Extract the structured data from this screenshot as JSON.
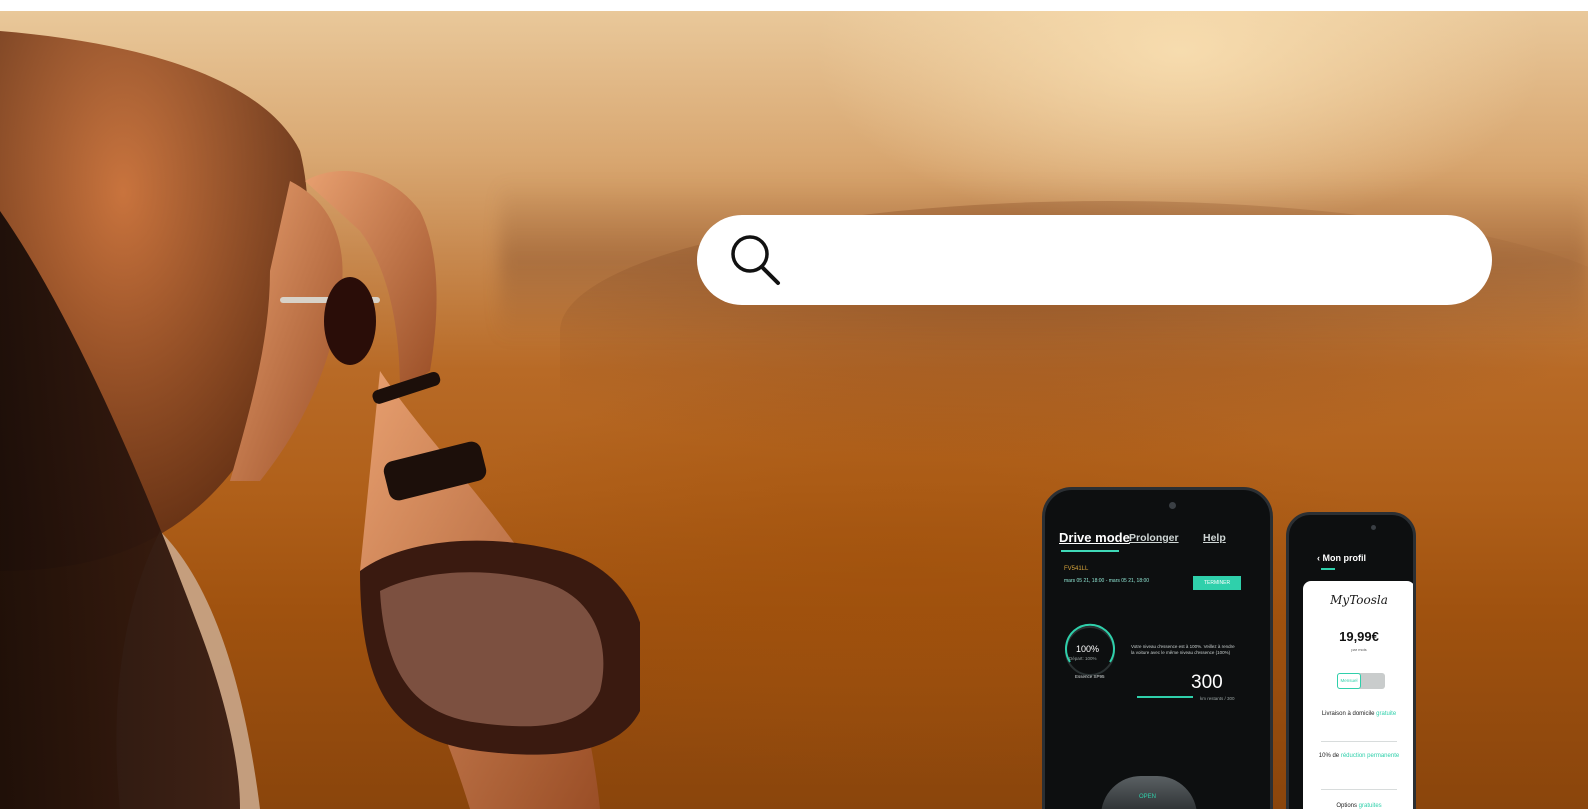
{
  "search": {
    "placeholder": "",
    "value": ""
  },
  "phone_drive": {
    "tabs": [
      "Drive mode",
      "Prolonger",
      "Help"
    ],
    "plate": "FV541LL",
    "dates": "mars 05 21, 18:00 - mars 05 21, 18:00",
    "button_label": "TERMINER",
    "fuel_percent": "100%",
    "fuel_sub": "Départ: 100%",
    "fuel_type": "Essence SP95",
    "notice": "Votre niveau d'essence est à 100%. Veillez à rendre la voiture avec le même niveau d'essence (100%)",
    "km": "300",
    "km_sub": "km restants / 300",
    "knob_label": "OPEN"
  },
  "phone_profile": {
    "back_label": "‹ Mon profil",
    "logo": "MyToosla",
    "price": "19,99€",
    "per_month": "par mois",
    "toggle_on": "Mensuel",
    "toggle_off": "Annuel",
    "features": [
      {
        "text": "Livraison à domicile ",
        "highlight": "gratuite"
      },
      {
        "text": "10% de ",
        "highlight": "réduction permanente"
      },
      {
        "text": "Options ",
        "highlight": "gratuites"
      }
    ]
  },
  "colors": {
    "accent": "#2fd0ab",
    "search_bg": "#ffffff",
    "phone_bg": "#0d0f10"
  }
}
